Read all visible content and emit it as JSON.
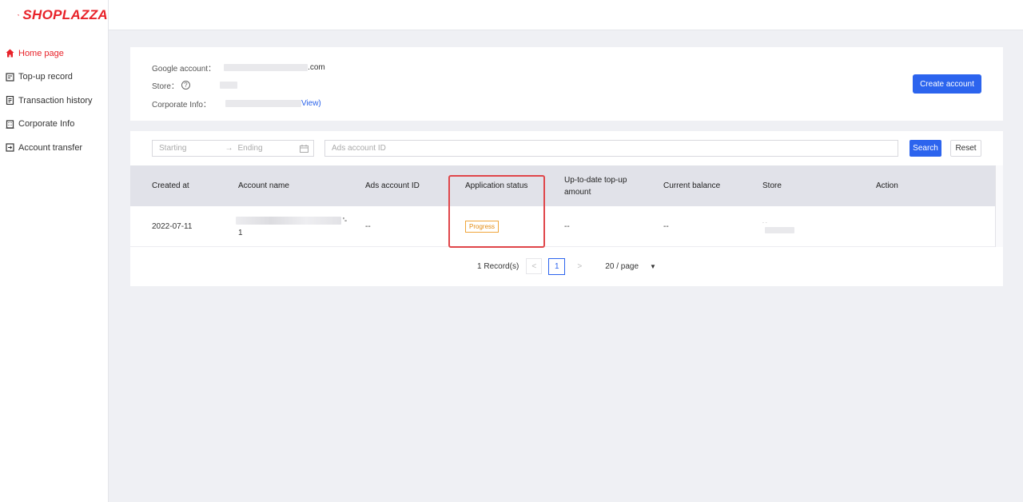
{
  "brand": {
    "name": "SHOPLAZZA",
    "color": "#e8232a"
  },
  "sidebar": {
    "items": [
      {
        "label": "Home page",
        "icon": "home-icon",
        "active": true
      },
      {
        "label": "Top-up record",
        "icon": "record-icon"
      },
      {
        "label": "Transaction history",
        "icon": "document-icon"
      },
      {
        "label": "Corporate Info",
        "icon": "building-icon"
      },
      {
        "label": "Account transfer",
        "icon": "transfer-icon"
      }
    ]
  },
  "info": {
    "google_label": "Google account：",
    "google_suffix": ".com",
    "store_label": "Store：",
    "corporate_label": "Corporate Info：",
    "corporate_link": "View)",
    "create_button": "Create account"
  },
  "filters": {
    "start_placeholder": "Starting",
    "arrow": "→",
    "end_placeholder": "Ending",
    "ads_id_placeholder": "Ads account ID",
    "search_button": "Search",
    "reset_button": "Reset"
  },
  "table": {
    "columns": [
      "Created at",
      "Account name",
      "Ads account ID",
      "Application status",
      "Up-to-date top-up amount",
      "Current balance",
      "Store",
      "Action"
    ],
    "rows": [
      {
        "created_at": "2022-07-11",
        "account_name_tail": "'-",
        "account_name_line2": "1",
        "ads_account_id": "--",
        "status": "Progress",
        "top_up_amount": "--",
        "current_balance": "--",
        "store_mark": ". ."
      }
    ]
  },
  "pagination": {
    "records": "1 Record(s)",
    "prev": "<",
    "current_page": "1",
    "next": ">",
    "page_size": "20 / page",
    "caret": "▼"
  },
  "colors": {
    "primary": "#2c64ee",
    "status_progress": "#e38b10",
    "highlight": "#e0464a"
  }
}
